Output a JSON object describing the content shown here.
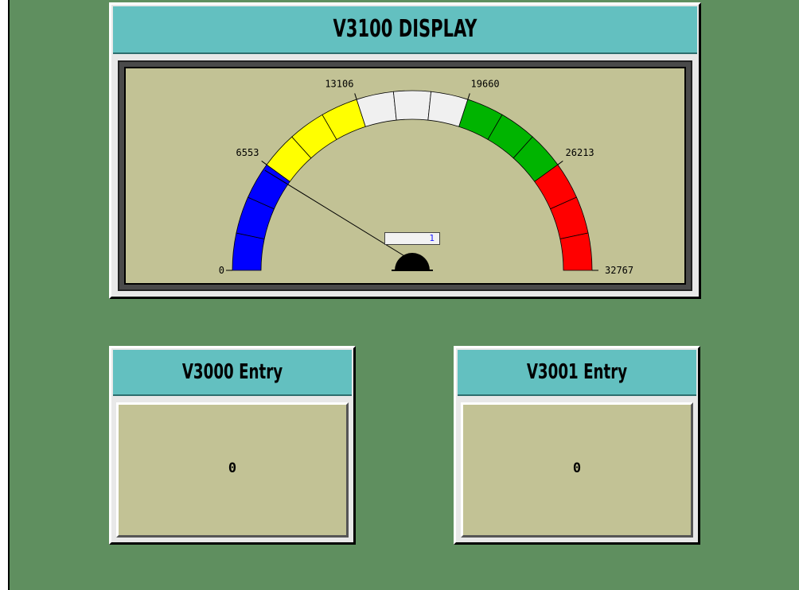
{
  "display": {
    "title": "V3100 DISPLAY",
    "gauge": {
      "min": 0,
      "max": 32767,
      "value": 1,
      "readout": "1",
      "tick_labels": [
        "0",
        "6553",
        "13106",
        "19660",
        "26213",
        "32767"
      ],
      "bands": [
        {
          "from": 0,
          "to": 6553,
          "color": "#0000ff"
        },
        {
          "from": 6553,
          "to": 13106,
          "color": "#ffff00"
        },
        {
          "from": 13106,
          "to": 19660,
          "color": "#f0f0f0"
        },
        {
          "from": 19660,
          "to": 26213,
          "color": "#00b400"
        },
        {
          "from": 26213,
          "to": 32767,
          "color": "#ff0000"
        }
      ],
      "segments_per_band": 3
    }
  },
  "entries": [
    {
      "title": "V3000 Entry",
      "value": "0"
    },
    {
      "title": "V3001 Entry",
      "value": "0"
    }
  ],
  "colors": {
    "background": "#5f8f5f",
    "title_bar": "#63c0c0",
    "face": "#c2c295"
  }
}
